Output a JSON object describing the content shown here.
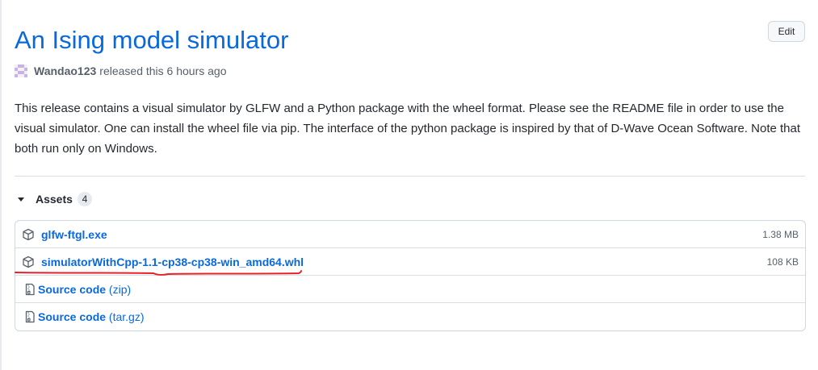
{
  "release": {
    "title": "An Ising model simulator",
    "edit_label": "Edit",
    "author": "Wandao123",
    "released_text": "released this 6 hours ago",
    "description": "This release contains a visual simulator by GLFW and a Python package with the wheel format. Please see the README file in order to use the visual simulator. One can install the wheel file via pip. The interface of the python package is inspired by that of D-Wave Ocean Software. Note that both run only on Windows."
  },
  "assets": {
    "label": "Assets",
    "count": "4",
    "files": [
      {
        "name": "glfw-ftgl.exe",
        "size": "1.38 MB",
        "icon": "package-icon"
      },
      {
        "name": "simulatorWithCpp-1.1-cp38-cp38-win_amd64.whl",
        "size": "108 KB",
        "icon": "package-icon"
      }
    ],
    "sources": [
      {
        "label": "Source code",
        "ext": "(zip)",
        "icon": "file-zip-icon"
      },
      {
        "label": "Source code",
        "ext": "(tar.gz)",
        "icon": "file-zip-icon"
      }
    ]
  },
  "colors": {
    "link": "#0969da",
    "annotation": "#e8202a"
  }
}
